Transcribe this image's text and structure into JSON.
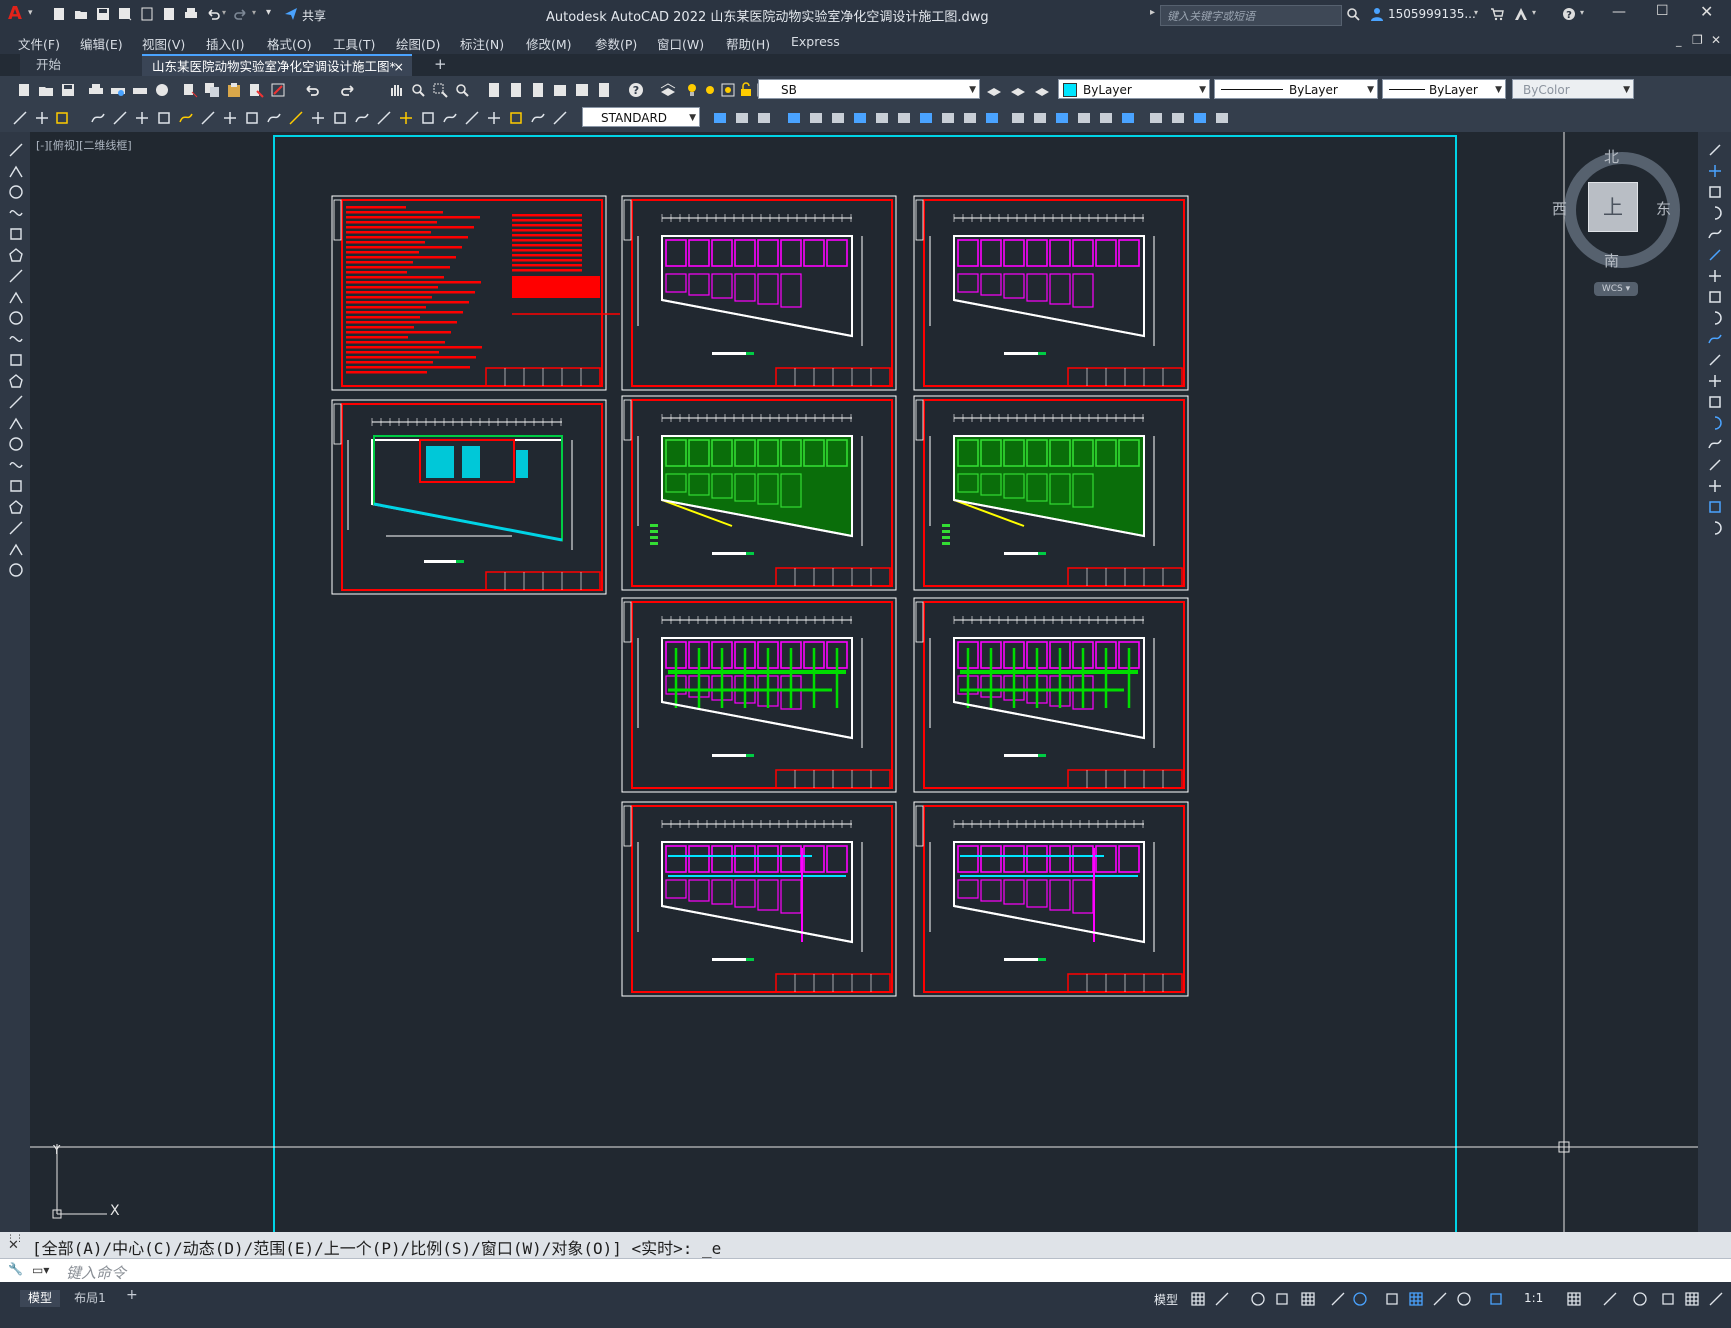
{
  "app": {
    "title": "Autodesk AutoCAD 2022    山东某医院动物实验室净化空调设计施工图.dwg",
    "logo_letter": "A",
    "share_label": "共享",
    "search_placeholder": "键入关键字或短语",
    "user": "1505999135...",
    "window_controls": [
      "minimize-icon",
      "restore-icon",
      "close-icon"
    ]
  },
  "menus": [
    "文件(F)",
    "编辑(E)",
    "视图(V)",
    "插入(I)",
    "格式(O)",
    "工具(T)",
    "绘图(D)",
    "标注(N)",
    "修改(M)",
    "参数(P)",
    "窗口(W)",
    "帮助(H)",
    "Express"
  ],
  "tabs": {
    "start": "开始",
    "active": "山东某医院动物实验室净化空调设计施工图*",
    "close": "×",
    "add": "+"
  },
  "toolbar": {
    "layer": "SB",
    "color": "ByLayer",
    "linetype": "ByLayer",
    "lineweight": "ByLayer",
    "plotstyle": "ByColor",
    "textstyle": "STANDARD"
  },
  "viewport": {
    "label": "[-][俯视][二维线框]",
    "compass": {
      "n": "北",
      "s": "南",
      "e": "东",
      "w": "西",
      "center": "上"
    },
    "wcs": "WCS ▾",
    "ucs_y": "Y",
    "ucs_x": "X"
  },
  "command": {
    "history": "[全部(A)/中心(C)/动态(D)/范围(E)/上一个(P)/比例(S)/窗口(W)/对象(O)] <实时>: _e",
    "placeholder": "键入命令"
  },
  "status": {
    "layout_tabs": [
      "模型",
      "布局1"
    ],
    "add": "+",
    "model_label": "模型",
    "scale": "1:1"
  },
  "colors": {
    "background": "#212830",
    "accent_cyan": "#00d4e6",
    "sheet_red": "#ff0000",
    "frame_white": "#ffffff",
    "magenta": "#ff00ff",
    "green": "#00cc00"
  }
}
